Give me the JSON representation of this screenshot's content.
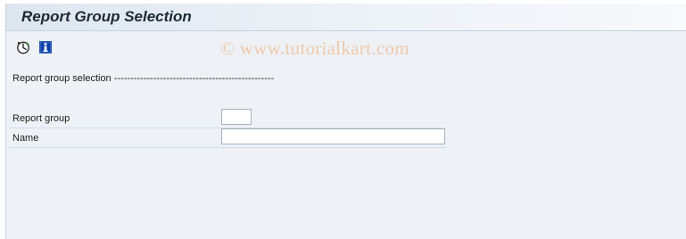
{
  "window": {
    "title": "Report Group Selection"
  },
  "toolbar": {
    "buttons": [
      {
        "name": "execute",
        "icon": "execute-clock-icon"
      },
      {
        "name": "information",
        "icon": "info-icon"
      }
    ]
  },
  "watermark": "© www.tutorialkart.com",
  "section": {
    "title": "Report group selection -------------------------------------------------"
  },
  "fields": {
    "report_group": {
      "label": "Report group",
      "value": ""
    },
    "name": {
      "label": "Name",
      "value": ""
    }
  },
  "colors": {
    "background": "#eef2f7",
    "title_text": "#1e2a36",
    "watermark": "#f0c8a8",
    "icon_blue": "#0a3ea8"
  }
}
